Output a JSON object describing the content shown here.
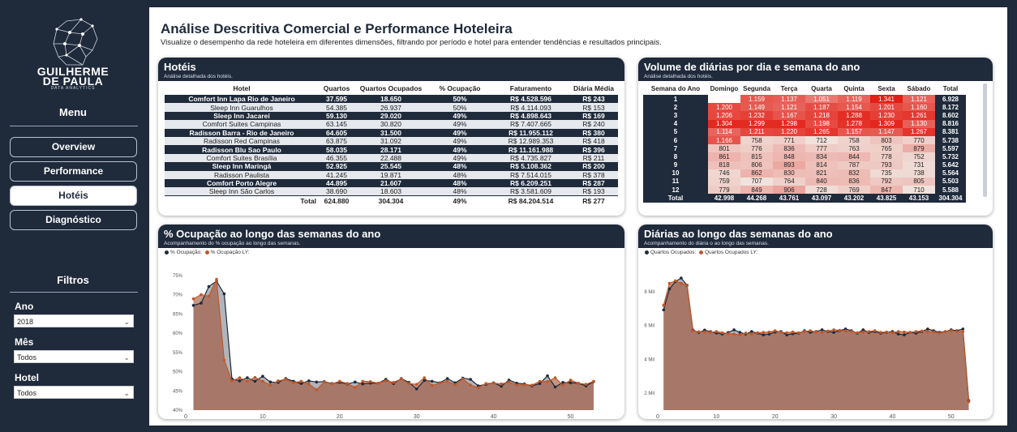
{
  "brand": {
    "line1": "GUILHERME",
    "line2": "DE PAULA",
    "tagline": "DATA ANALYTICS"
  },
  "sidebar": {
    "menu_title": "Menu",
    "nav": [
      {
        "label": "Overview",
        "active": false
      },
      {
        "label": "Performance",
        "active": false
      },
      {
        "label": "Hotéis",
        "active": true
      },
      {
        "label": "Diagnóstico",
        "active": false
      }
    ],
    "filters_title": "Filtros",
    "filters": [
      {
        "label": "Ano",
        "value": "2018"
      },
      {
        "label": "Mês",
        "value": "Todos"
      },
      {
        "label": "Hotel",
        "value": "Todos"
      }
    ]
  },
  "header": {
    "title": "Análise Descritiva Comercial e Performance Hoteleira",
    "subtitle": "Visualize o desempenho da rede hoteleira em diferentes dimensões, filtrando por período e hotel para entender tendências e resultados principais."
  },
  "hotels_card": {
    "title": "Hotéis",
    "subtitle": "Análise detalhada dos hotéis.",
    "columns": [
      "Hotel",
      "Quartos",
      "Quartos Ocupados",
      "% Ocupação",
      "Faturamento",
      "Diária Média"
    ],
    "rows": [
      [
        "Comfort Inn Lapa Rio de Janeiro",
        "37.595",
        "18.650",
        "50%",
        "R$ 4.528.596",
        "R$ 243"
      ],
      [
        "Sleep Inn Guarulhos",
        "54.385",
        "26.937",
        "50%",
        "R$ 4.114.093",
        "R$ 153"
      ],
      [
        "Sleep Inn Jacareí",
        "59.130",
        "29.020",
        "49%",
        "R$ 4.898.643",
        "R$ 169"
      ],
      [
        "Comfort Suites Campinas",
        "63.145",
        "30.820",
        "49%",
        "R$ 7.407.665",
        "R$ 240"
      ],
      [
        "Radisson Barra - Rio de Janeiro",
        "64.605",
        "31.500",
        "49%",
        "R$ 11.955.112",
        "R$ 380"
      ],
      [
        "Radisson Red Campinas",
        "63.875",
        "31.092",
        "49%",
        "R$ 12.989.353",
        "R$ 418"
      ],
      [
        "Radisson Blu Sao Paulo",
        "58.035",
        "28.171",
        "49%",
        "R$ 11.161.988",
        "R$ 396"
      ],
      [
        "Comfort Suites Brasília",
        "46.355",
        "22.488",
        "49%",
        "R$ 4.735.827",
        "R$ 211"
      ],
      [
        "Sleep Inn Maringá",
        "52.925",
        "25.545",
        "48%",
        "R$ 5.108.362",
        "R$ 200"
      ],
      [
        "Radisson Paulista",
        "41.245",
        "19.871",
        "48%",
        "R$ 7.514.015",
        "R$ 378"
      ],
      [
        "Comfort Porto Alegre",
        "44.895",
        "21.607",
        "48%",
        "R$ 6.209.251",
        "R$ 287"
      ],
      [
        "Sleep Inn São Carlos",
        "38.690",
        "18.603",
        "48%",
        "R$ 3.581.609",
        "R$ 193"
      ]
    ],
    "total": [
      "Total",
      "624.880",
      "304.304",
      "49%",
      "R$ 84.204.514",
      "R$ 277"
    ]
  },
  "volume_card": {
    "title": "Volume de diárias por dia e semana do ano",
    "subtitle": "Análise detalhada dos hotéis.",
    "columns": [
      "Semana do Ano",
      "Domingo",
      "Segunda",
      "Terça",
      "Quarta",
      "Quinta",
      "Sexta",
      "Sábado",
      "Total"
    ],
    "rows": [
      [
        "1",
        "",
        "1.159",
        "1.137",
        "1.051",
        "1.119",
        "1.341",
        "1.121",
        "6.928"
      ],
      [
        "2",
        "1.200",
        "1.149",
        "1.121",
        "1.187",
        "1.154",
        "1.201",
        "1.160",
        "8.172"
      ],
      [
        "3",
        "1.206",
        "1.232",
        "1.167",
        "1.218",
        "1.288",
        "1.230",
        "1.261",
        "8.602"
      ],
      [
        "4",
        "1.304",
        "1.299",
        "1.298",
        "1.198",
        "1.278",
        "1.309",
        "1.130",
        "8.816"
      ],
      [
        "5",
        "1.114",
        "1.211",
        "1.220",
        "1.265",
        "1.157",
        "1.147",
        "1.267",
        "8.381"
      ],
      [
        "6",
        "1.166",
        "758",
        "771",
        "712",
        "758",
        "803",
        "770",
        "5.738"
      ],
      [
        "7",
        "801",
        "776",
        "836",
        "777",
        "763",
        "765",
        "879",
        "5.597"
      ],
      [
        "8",
        "861",
        "815",
        "848",
        "834",
        "844",
        "778",
        "752",
        "5.732"
      ],
      [
        "9",
        "818",
        "806",
        "893",
        "814",
        "787",
        "793",
        "731",
        "5.642"
      ],
      [
        "10",
        "746",
        "862",
        "830",
        "821",
        "832",
        "735",
        "738",
        "5.564"
      ],
      [
        "11",
        "759",
        "707",
        "764",
        "840",
        "836",
        "792",
        "805",
        "5.503"
      ],
      [
        "12",
        "779",
        "849",
        "906",
        "728",
        "769",
        "847",
        "710",
        "5.588"
      ]
    ],
    "total": [
      "Total",
      "42.998",
      "44.268",
      "43.761",
      "43.097",
      "43.202",
      "43.825",
      "43.153",
      "304.304"
    ]
  },
  "chart_data": [
    {
      "type": "area",
      "title": "% Ocupação ao longo das semanas do ano",
      "subtitle": "Acompanhamento do % ocupação ao longo das semanas.",
      "series": [
        {
          "name": "% Ocupação:",
          "color": "#1f2a3b",
          "values": [
            67.2,
            67.8,
            72.1,
            73.5,
            70.2,
            48.1,
            47.6,
            48.4,
            47.5,
            48.8,
            47.3,
            47.2,
            48.2,
            47.5,
            46.9,
            47.6,
            47.3,
            47.4,
            46.9,
            47.2,
            46.8,
            47.3,
            46.8,
            47.0,
            47.0,
            48.0,
            46.9,
            48.2,
            47.2,
            45.5,
            47.7,
            47.5,
            47.1,
            48.2,
            47.1,
            48.3,
            48.0,
            46.3,
            46.7,
            47.1,
            46.2,
            47.8,
            47.0,
            46.8,
            46.3,
            46.9,
            48.9,
            46.0,
            47.2,
            47.1,
            47.0,
            46.3,
            47.4
          ]
        },
        {
          "name": "% Ocupação LY:",
          "color": "#c0582a",
          "values": [
            68.9,
            70.0,
            69.6,
            74.0,
            53.0,
            47.6,
            48.4,
            47.5,
            48.5,
            47.5,
            46.5,
            47.6,
            48.0,
            47.1,
            47.5,
            46.8,
            45.3,
            47.3,
            46.8,
            47.5,
            46.9,
            45.9,
            47.5,
            47.4,
            47.0,
            47.6,
            47.2,
            48.1,
            46.9,
            46.7,
            48.4,
            46.4,
            47.0,
            47.5,
            46.6,
            48.1,
            46.5,
            45.8,
            46.9,
            47.0,
            46.8,
            47.3,
            46.5,
            46.6,
            46.5,
            47.5,
            47.4,
            48.4,
            46.5,
            47.8,
            47.0,
            46.7,
            47.5
          ]
        }
      ],
      "xticks": [
        0,
        10,
        20,
        30,
        40,
        50
      ],
      "yticks": [
        "40%",
        "45%",
        "50%",
        "55%",
        "60%",
        "65%",
        "70%",
        "75%"
      ],
      "ylim": [
        40,
        76
      ],
      "xlim": [
        0,
        55
      ]
    },
    {
      "type": "area",
      "title": "Diárias ao longo das semanas do ano",
      "subtitle": "Acompanhamento do diária o ao longo das semanas.",
      "series": [
        {
          "name": "Quartos Ocupados:",
          "color": "#1f2a3b",
          "values": [
            6928,
            8172,
            8602,
            8816,
            8381,
            5738,
            5597,
            5732,
            5642,
            5564,
            5503,
            5588,
            5750,
            5600,
            5500,
            5650,
            5550,
            5450,
            5500,
            5620,
            5650,
            5450,
            5520,
            5550,
            5700,
            5600,
            5650,
            5750,
            5650,
            5600,
            5700,
            5800,
            5700,
            5550,
            5750,
            5600,
            5650,
            5550,
            5600,
            5650,
            5500,
            5450,
            5600,
            5550,
            5650,
            5800,
            5700,
            5600,
            5650,
            5750,
            5700,
            5800,
            1560
          ]
        },
        {
          "name": "Quartos Ocupados LY:",
          "color": "#c0582a",
          "values": [
            7200,
            8500,
            8650,
            8500,
            8400,
            5680,
            5640,
            5620,
            5600,
            5650,
            5580,
            5520,
            5500,
            5450,
            5560,
            5500,
            5580,
            5600,
            5620,
            5700,
            5600,
            5580,
            5620,
            5580,
            5650,
            5700,
            5620,
            5600,
            5680,
            5750,
            5720,
            5680,
            5650,
            5580,
            5620,
            5650,
            5700,
            5600,
            5620,
            5580,
            5650,
            5620,
            5600,
            5650,
            5680,
            5650,
            5620,
            5550,
            5640,
            5700,
            5650,
            5660,
            1500
          ]
        }
      ],
      "xticks": [
        0,
        10,
        20,
        30,
        40,
        50
      ],
      "yticks": [
        "2 Mil",
        "4 Mil",
        "6 Mil",
        "8 Mil"
      ],
      "ylim": [
        1000,
        9200
      ],
      "xlim": [
        0,
        55
      ]
    }
  ]
}
